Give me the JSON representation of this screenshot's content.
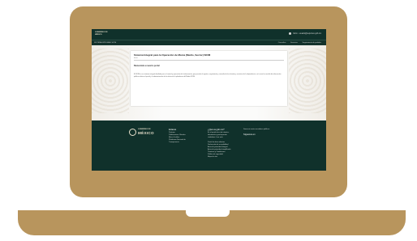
{
  "header": {
    "logo_line1": "GOBIERNO DE",
    "logo_line2": "MÉXICO",
    "user_text": "Inicio · usuario@sepomex.gob.mx",
    "system_name": "SISTEMA INTEGRAL SIOM",
    "menu": [
      "Consultas",
      "Servicios",
      "Seguimiento de pedidos"
    ]
  },
  "card": {
    "title": "Sistema Integral para la Operación de Marca (Medio, Sector) SIOM",
    "breadcrumb": "Inicio",
    "welcome": "Bienvenido a nuestro portal",
    "paragraph": "El SIOM es un sistema integral diseñado para el control y operación de la información, que permite el registro, seguimiento y consulta de los trámites y servicios de la dependencia, así como la consulta de información pública relativa al portal y la administración de los datos de la plataforma del Medio SIOM."
  },
  "footer": {
    "logo_line1": "GOBIERNO DE",
    "logo_line2": "MÉXICO",
    "col1_title": "Enlaces",
    "col1_links": [
      "Participa",
      "Publicaciones Oficiales",
      "Marco Jurídico",
      "Plataforma Nacional de",
      "Transparencia"
    ],
    "col2_title": "¿Qué es gob.mx?",
    "col2_text": [
      "Es el portal único de trámites,",
      "información y participación",
      "ciudadana. Leer más"
    ],
    "col2_links": [
      "Portal de datos abiertos",
      "Declaración de accesibilidad",
      "Aviso de privacidad integral",
      "Aviso de privacidad simplificado",
      "Términos y Condiciones",
      "Política de seguridad",
      "Mapa de sitio"
    ],
    "col3_title": "Denuncia contra servidores públicos",
    "col3_social": "Síguenos en"
  }
}
